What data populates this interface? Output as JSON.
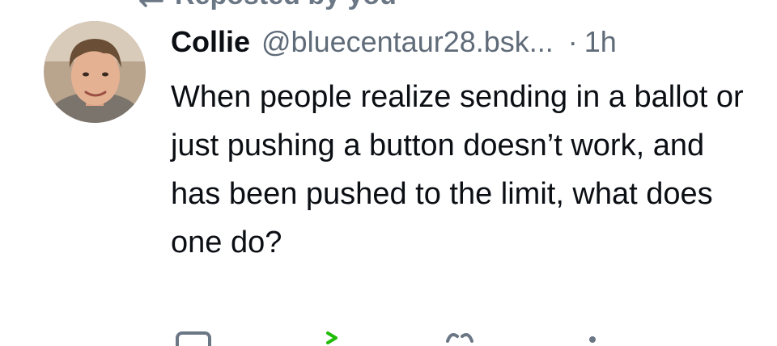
{
  "repost": {
    "label": "Reposted by you",
    "icon": "repost-icon"
  },
  "post": {
    "author_name": "Collie",
    "handle": "@bluecentaur28.bsk...",
    "separator": "·",
    "timestamp": "1h",
    "text": "When people realize sending in a ballot or just pushing a button doesn’t work, and has been pushed to the limit, what does one do?"
  },
  "actions": [
    {
      "icon": "reply-icon"
    },
    {
      "icon": "repost-icon"
    },
    {
      "icon": "like-icon"
    },
    {
      "icon": "more-icon"
    }
  ],
  "colors": {
    "text": "#0b0f14",
    "secondary": "#5f6b78",
    "repost_accent": "#20bc07"
  }
}
